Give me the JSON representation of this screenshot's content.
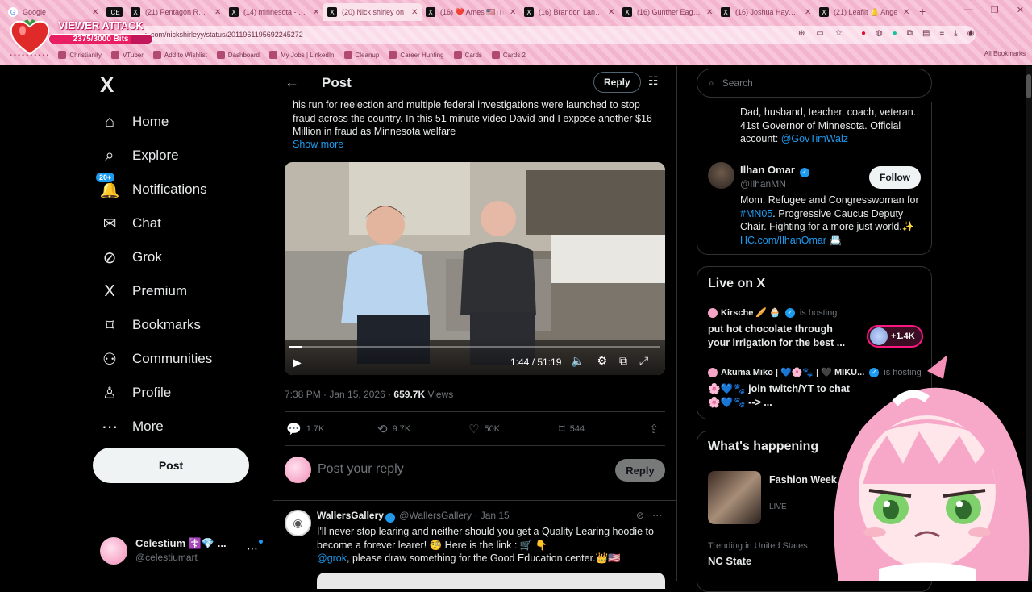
{
  "browser": {
    "tabs": [
      {
        "title": "Google",
        "icon": "G",
        "iconType": "g"
      },
      {
        "title": "ICE",
        "icon": "ICE",
        "iconType": "x"
      },
      {
        "title": "(21) Pentagon Readi",
        "icon": "X",
        "iconType": "x"
      },
      {
        "title": "(14) minnesota - Sea",
        "icon": "X",
        "iconType": "x"
      },
      {
        "title": "(20) Nick shirley on",
        "icon": "X",
        "iconType": "x",
        "active": true
      },
      {
        "title": "(16) ❤️ Ames 🇺🇸 🇮",
        "icon": "X",
        "iconType": "x"
      },
      {
        "title": "(16) Brandon Lansdo",
        "icon": "X",
        "iconType": "x"
      },
      {
        "title": "(16) Gunther Eaglem",
        "icon": "X",
        "iconType": "x"
      },
      {
        "title": "(16) Joshua Haymes",
        "icon": "X",
        "iconType": "x"
      },
      {
        "title": "(21) Leaflit 🔔 Ange",
        "icon": "X",
        "iconType": "x"
      }
    ],
    "url": "x.com/nickshirleyy/status/2011961195692245272",
    "bookmarks": [
      "Christianity",
      "VTuber",
      "Add to Wishlist",
      "Dashboard",
      "My Jobs | LinkedIn",
      "Cleanup",
      "Career Hunting",
      "Cards",
      "Cards 2"
    ],
    "all_bookmarks": "All Bookmarks"
  },
  "overlay": {
    "title": "VIEWER ATTACK",
    "bits_label": "2375/3000 Bits",
    "bits_fraction": 0.7917
  },
  "nav": {
    "logo": "X",
    "items": [
      {
        "label": "Home",
        "icon": "⌂"
      },
      {
        "label": "Explore",
        "icon": "⌕"
      },
      {
        "label": "Notifications",
        "icon": "🔔",
        "badge": "20+"
      },
      {
        "label": "Chat",
        "icon": "✉"
      },
      {
        "label": "Grok",
        "icon": "⊘"
      },
      {
        "label": "Premium",
        "icon": "X"
      },
      {
        "label": "Bookmarks",
        "icon": "⌑"
      },
      {
        "label": "Communities",
        "icon": "⚇"
      },
      {
        "label": "Profile",
        "icon": "♙"
      },
      {
        "label": "More",
        "icon": "⋯"
      }
    ],
    "post_button": "Post",
    "account": {
      "name": "Celestium ☦️💎 ...",
      "handle": "@celestiumart"
    }
  },
  "post": {
    "header": "Post",
    "reply_button": "Reply",
    "text": "his run for reelection and multiple federal investigations were launched to stop fraud across the country. In this 51 minute video David and I expose another $16 Million in fraud as Minnesota welfare",
    "show_more": "Show more",
    "video": {
      "time": "1:44 / 51:19",
      "progress": 0.034
    },
    "meta_time": "7:38 PM · Jan 15, 2026 · ",
    "views_count": "659.7K",
    "views_label": " Views",
    "stats": {
      "replies": "1.7K",
      "reposts": "9.7K",
      "likes": "50K",
      "bookmarks": "544"
    },
    "reply_placeholder": "Post your reply",
    "reply_submit": "Reply"
  },
  "reply_tweet": {
    "name": "WallersGallery",
    "handle": "@WallersGallery",
    "date": "· Jan 15",
    "line1": "I'll never stop learing and neither should you get a Quality Learing hoodie to become a forever learer! 🧐 Here is the link : 🛒 👇",
    "mention": "@grok",
    "line2": ", please draw something for the Good Education center.👑🇺🇸"
  },
  "sidebar": {
    "search_placeholder": "Search",
    "walz_bio": "Dad, husband, teacher, coach, veteran. 41st Governor of Minnesota. Official account: ",
    "walz_link": "@GovTimWalz",
    "omar": {
      "name": "Ilhan Omar",
      "handle": "@IlhanMN",
      "follow": "Follow",
      "bio1": "Mom, Refugee and Congresswoman for ",
      "bio_tag": "#MN05",
      "bio2": ". Progressive Caucus Deputy Chair. Fighting for a more just world.✨ ",
      "bio_link": "HC.com/IlhanOmar",
      "bio_end": " 📇"
    },
    "live": {
      "title": "Live on X",
      "items": [
        {
          "host": "Kirsche 🥖 🧁",
          "hosting": "is hosting",
          "title": "put hot chocolate through your irrigation for the best ...",
          "listeners": "+1.4K"
        },
        {
          "host": "Akuma Miko | 💙🌸🐾 | 🖤 MIKU...",
          "hosting": "is hosting",
          "title": "🌸💙🐾 join twitch/YT to chat 🌸💙🐾 --> ..."
        }
      ]
    },
    "happening": {
      "title": "What's happening",
      "event_title": "Fashion Week FW26 & ...",
      "event_status": "LIVE",
      "trend_label": "Trending in United States",
      "trend_name": "NC State"
    }
  },
  "colors": {
    "accent": "#1d9bf0",
    "chrome_pink": "#f7c6d9",
    "live_pink": "#f91880"
  }
}
